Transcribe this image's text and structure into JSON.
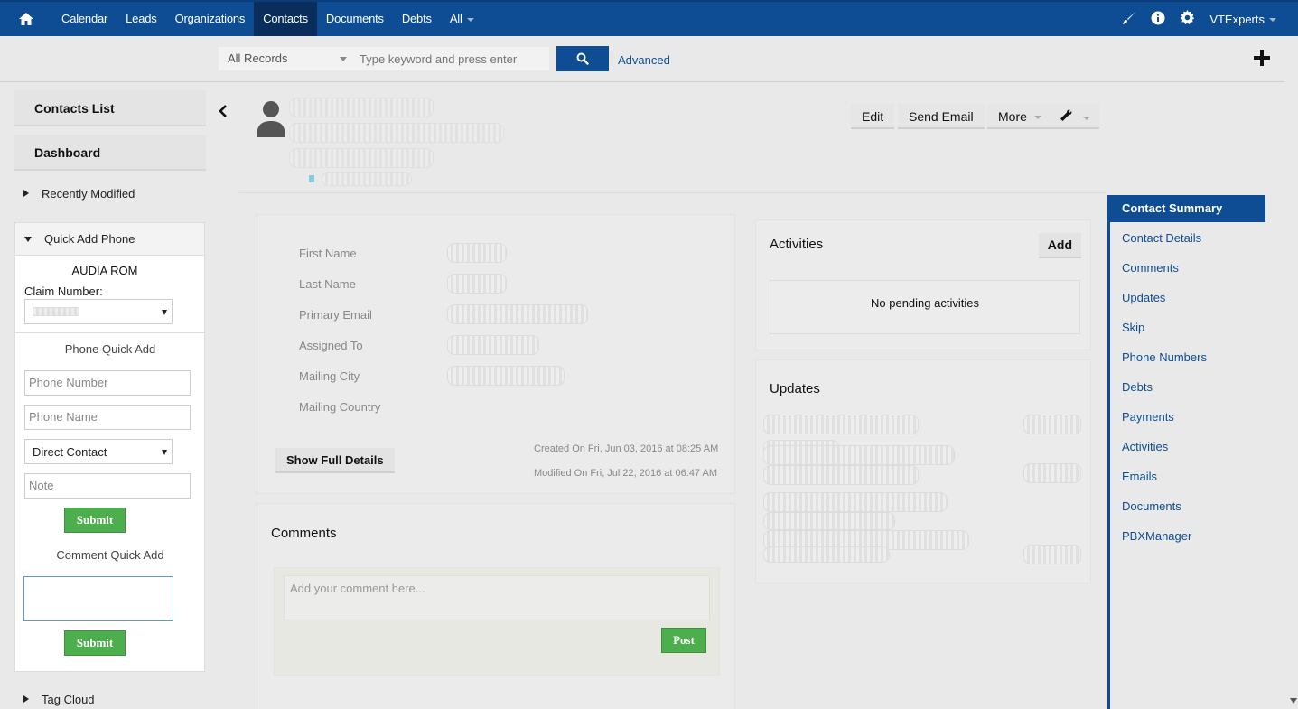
{
  "topnav": {
    "items": [
      "Calendar",
      "Leads",
      "Organizations",
      "Contacts",
      "Documents",
      "Debts",
      "All"
    ],
    "active": "Contacts",
    "user": "VTExperts"
  },
  "search": {
    "scope": "All Records",
    "placeholder": "Type keyword and press enter",
    "advanced": "Advanced"
  },
  "sidebar": {
    "contacts_list": "Contacts List",
    "dashboard": "Dashboard",
    "recently_modified": "Recently Modified",
    "quick_add_phone": "Quick Add Phone",
    "tag_cloud": "Tag Cloud"
  },
  "quick_add": {
    "name": "AUDIA ROM",
    "claim_label": "Claim Number:",
    "phone_quick_add": "Phone Quick Add",
    "phone_number_placeholder": "Phone Number",
    "phone_name_placeholder": "Phone Name",
    "contact_type": "Direct Contact",
    "note_placeholder": "Note",
    "submit": "Submit",
    "comment_quick_add": "Comment Quick Add"
  },
  "actions": {
    "edit": "Edit",
    "send_email": "Send Email",
    "more": "More"
  },
  "summary": {
    "fields": [
      "First Name",
      "Last Name",
      "Primary Email",
      "Assigned To",
      "Mailing City",
      "Mailing Country"
    ],
    "show_full": "Show Full Details",
    "created": "Created On Fri, Jun 03, 2016 at 08:25 AM",
    "modified": "Modified On Fri, Jul 22, 2016 at 06:47 AM"
  },
  "activities": {
    "title": "Activities",
    "add": "Add",
    "empty": "No pending activities"
  },
  "updates": {
    "title": "Updates"
  },
  "comments": {
    "title": "Comments",
    "placeholder": "Add your comment here...",
    "post": "Post"
  },
  "right_nav": {
    "items": [
      "Contact Summary",
      "Contact Details",
      "Comments",
      "Updates",
      "Skip",
      "Phone Numbers",
      "Debts",
      "Payments",
      "Activities",
      "Emails",
      "Documents",
      "PBXManager"
    ]
  },
  "colors": {
    "brand": "#0e4d93",
    "submit_green": "#4cae4c"
  }
}
